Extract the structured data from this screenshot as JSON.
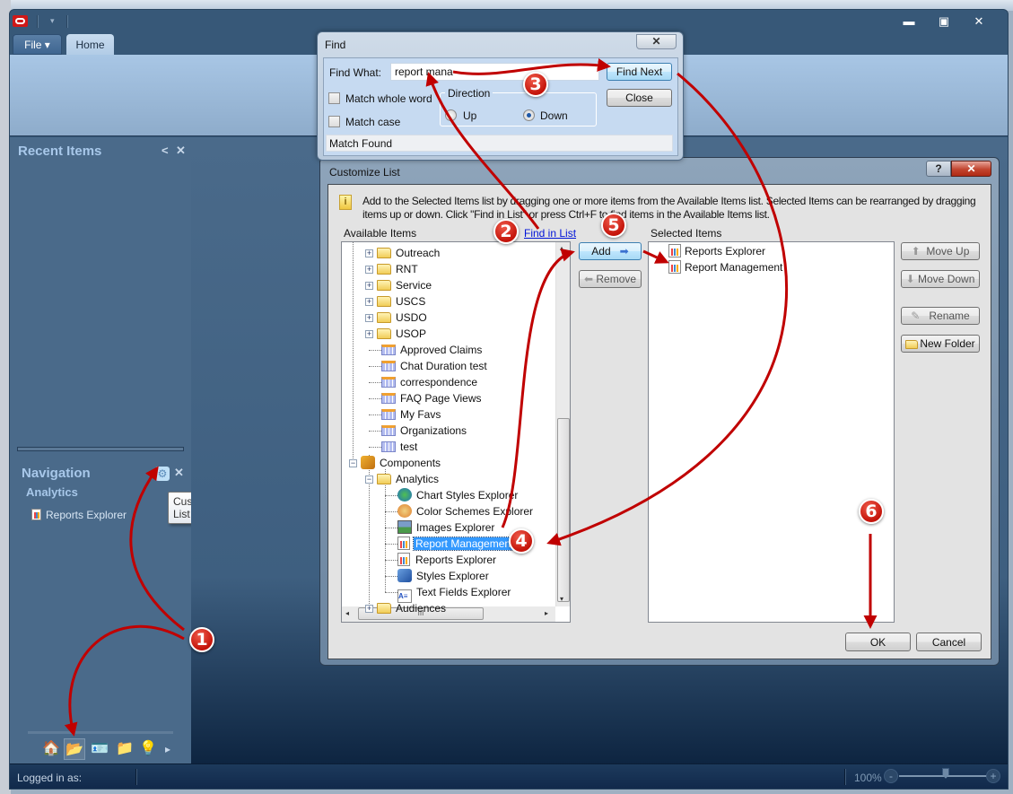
{
  "app": {
    "tabs": {
      "file": "File ▾",
      "home": "Home"
    },
    "window_controls": {
      "minimize": "▬",
      "maximize": "▣",
      "close": "✕"
    }
  },
  "sidebar": {
    "recent_items": {
      "title": "Recent Items",
      "collapse": "<",
      "close": "✕"
    },
    "navigation": {
      "title": "Navigation",
      "close": "✕",
      "section": "Analytics",
      "items": [
        {
          "label": "Reports Explorer"
        }
      ],
      "tooltip": "Customize List"
    },
    "nav_buttons": [
      {
        "name": "home",
        "glyph": "🏠"
      },
      {
        "name": "analytics",
        "glyph": "📂",
        "active": true
      },
      {
        "name": "contacts",
        "glyph": "🪪"
      },
      {
        "name": "incidents",
        "glyph": "📁"
      },
      {
        "name": "answers",
        "glyph": "💡"
      },
      {
        "name": "more",
        "glyph": "▸"
      }
    ]
  },
  "status_bar": {
    "logged_in": "Logged in as:",
    "zoom_label": "100%",
    "zoom_minus": "-",
    "zoom_plus": "+",
    "zoom_percent": 100
  },
  "find_dialog": {
    "title": "Find",
    "close": "✕",
    "find_what_label": "Find What:",
    "find_what_value": "report mana",
    "match_whole_word": {
      "label": "Match whole word",
      "checked": false
    },
    "match_case": {
      "label": "Match case",
      "checked": false
    },
    "direction_label": "Direction",
    "direction_up": "Up",
    "direction_down": "Down",
    "direction_selected": "Down",
    "find_next": "Find Next",
    "close_button": "Close",
    "status": "Match Found"
  },
  "customize_dialog": {
    "title": "Customize List",
    "help": "?",
    "close": "✕",
    "info": "Add to the Selected Items list by dragging one or more items from the Available Items list. Selected Items can be rearranged by dragging items up or down. Click \"Find in List\" or press Ctrl+F to find items in the Available Items list.",
    "available_label": "Available Items",
    "find_in_list": "Find in List",
    "selected_label": "Selected Items",
    "add": "Add",
    "remove": "Remove",
    "move_up": "Move Up",
    "move_down": "Move Down",
    "rename": "Rename",
    "new_folder": "New Folder",
    "ok": "OK",
    "cancel": "Cancel",
    "tree": [
      {
        "label": "Outreach",
        "type": "folder",
        "level": 1,
        "expander": "+"
      },
      {
        "label": "RNT",
        "type": "folder",
        "level": 1,
        "expander": "+"
      },
      {
        "label": "Service",
        "type": "folder",
        "level": 1,
        "expander": "+"
      },
      {
        "label": "USCS",
        "type": "folder",
        "level": 1,
        "expander": "+"
      },
      {
        "label": "USDO",
        "type": "folder",
        "level": 1,
        "expander": "+"
      },
      {
        "label": "USOP",
        "type": "folder",
        "level": 1,
        "expander": "+"
      },
      {
        "label": "Approved Claims",
        "type": "report-grid",
        "level": 1
      },
      {
        "label": "Chat Duration test",
        "type": "report-grid",
        "level": 1
      },
      {
        "label": "correspondence",
        "type": "report-grid",
        "level": 1
      },
      {
        "label": "FAQ Page Views",
        "type": "report-grid",
        "level": 1
      },
      {
        "label": "My Favs",
        "type": "report-grid",
        "level": 1
      },
      {
        "label": "Organizations",
        "type": "report-grid",
        "level": 1
      },
      {
        "label": "test",
        "type": "grid",
        "level": 1
      },
      {
        "label": "Components",
        "type": "components",
        "level": 0,
        "expander": "−"
      },
      {
        "label": "Analytics",
        "type": "folder",
        "level": 1,
        "expander": "−"
      },
      {
        "label": "Chart Styles Explorer",
        "type": "chart-styles",
        "level": 2
      },
      {
        "label": "Color Schemes Explorer",
        "type": "color-schemes",
        "level": 2
      },
      {
        "label": "Images Explorer",
        "type": "images",
        "level": 2
      },
      {
        "label": "Report Management",
        "type": "report",
        "level": 2,
        "selected": true
      },
      {
        "label": "Reports Explorer",
        "type": "report",
        "level": 2
      },
      {
        "label": "Styles Explorer",
        "type": "styles",
        "level": 2
      },
      {
        "label": "Text Fields Explorer",
        "type": "text-fields",
        "level": 2
      },
      {
        "label": "Audiences",
        "type": "folder",
        "level": 1,
        "expander": "+"
      }
    ],
    "selected_items": [
      {
        "label": "Reports Explorer"
      },
      {
        "label": "Report Management"
      }
    ]
  },
  "annotations": {
    "steps": [
      "1",
      "2",
      "3",
      "4",
      "5",
      "6"
    ],
    "color": "#c00000"
  }
}
